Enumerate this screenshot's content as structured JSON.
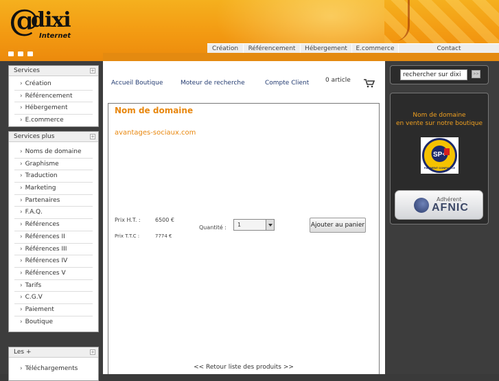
{
  "header": {
    "logo_at": "@",
    "logo_dixi": "dixi",
    "logo_sub": "Internet",
    "icons": [
      "home-icon",
      "mail-icon",
      "folder-icon"
    ],
    "brand_color": "#f39a12"
  },
  "nav": {
    "items": [
      "Création",
      "Référencement",
      "Hébergement",
      "E.commerce",
      "Contact"
    ]
  },
  "sidebar": {
    "services": {
      "title": "Services",
      "toggle": "+",
      "items": [
        "Création",
        "Référencement",
        "Hébergement",
        "E.commerce"
      ]
    },
    "services_plus": {
      "title": "Services plus",
      "toggle": "+",
      "items": [
        "Noms de domaine",
        "Graphisme",
        "Traduction",
        "Marketing",
        "Partenaires",
        "F.A.Q.",
        "Références",
        "Références II",
        "Références III",
        "Références IV",
        "Références V",
        "Tarifs",
        "C.G.V",
        "Paiement",
        "Boutique"
      ]
    },
    "les_plus": {
      "title": "Les +",
      "toggle": "+",
      "items": [
        "Téléchargements"
      ]
    },
    "arrow": "›"
  },
  "topbar": {
    "accueil": "Accueil Boutique",
    "moteur": "Moteur de recherche",
    "compte": "Compte Client",
    "cart_count": "0 article",
    "cart_icon": "cart-icon"
  },
  "product": {
    "title": "Nom de domaine",
    "domain": "avantages-sociaux.com",
    "ht_label": "Prix H.T.  :",
    "ht_value": "6500 €",
    "ttc_label": "Prix T.T.C :",
    "ttc_value": "7774 €",
    "qty_label": "Quantité :",
    "qty_value": "1",
    "add_button": "Ajouter au panier",
    "back_link": "<< Retour liste des produits >>"
  },
  "right": {
    "search_value": "rechercher sur dixi",
    "search_go": ">>",
    "promo_line1": "Nom de domaine",
    "promo_line2": "en vente sur notre boutique",
    "badge_text": "SP+",
    "badge_caption": "PAIEMENT CONFIANCE",
    "afnic_small": "Adhérent",
    "afnic_big": "AFNIC"
  }
}
